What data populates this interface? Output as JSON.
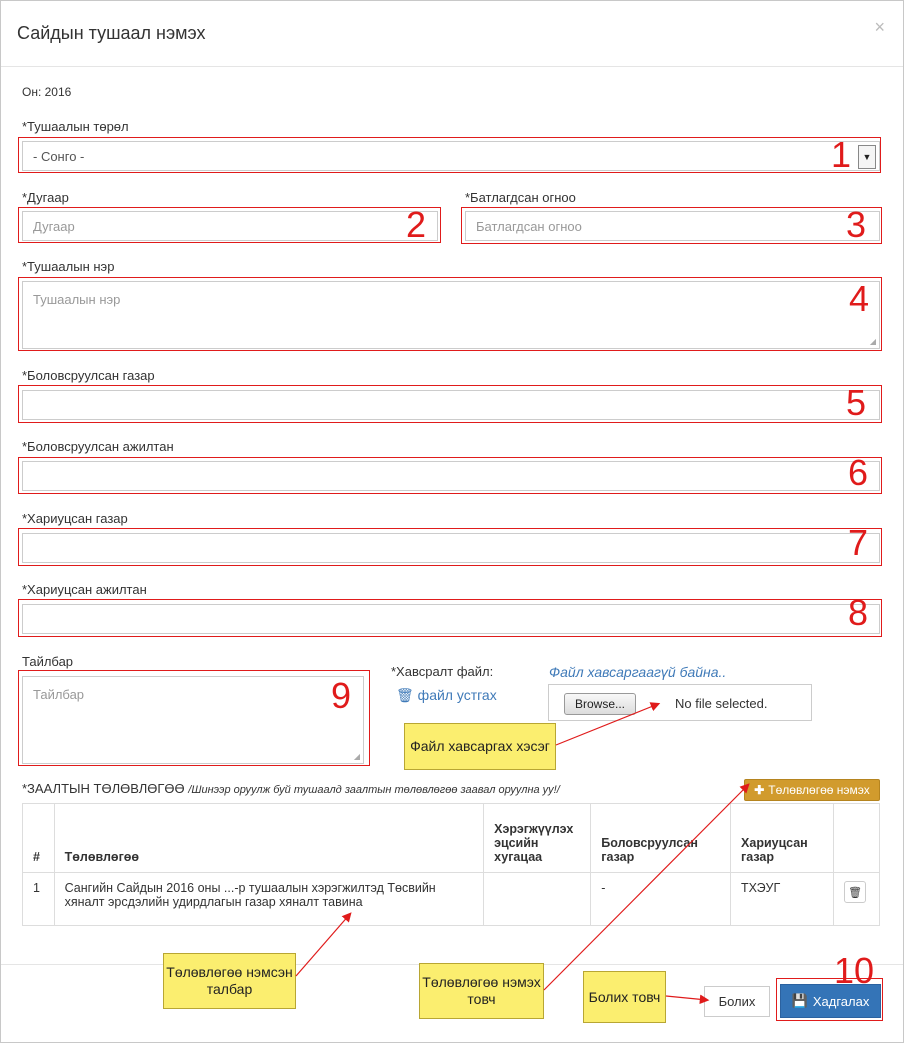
{
  "dialog": {
    "title": "Сайдын тушаал нэмэх",
    "close_symbol": "×",
    "year_label": "Он: 2016"
  },
  "form": {
    "order_type_label": "*Тушаалын төрөл",
    "order_type_value": "- Сонго -",
    "number_label": "*Дугаар",
    "number_placeholder": "Дугаар",
    "approved_date_label": "*Батлагдсан огноо",
    "approved_date_placeholder": "Батлагдсан огноо",
    "order_name_label": "*Тушаалын нэр",
    "order_name_placeholder": "Тушаалын нэр",
    "developed_org_label": "*Боловсруулсан газар",
    "developed_staff_label": "*Боловсруулсан ажилтан",
    "responsible_org_label": "*Хариуцсан газар",
    "responsible_staff_label": "*Хариуцсан ажилтан",
    "note_label": "Тайлбар",
    "note_placeholder": "Тайлбар"
  },
  "attachment": {
    "label": "*Хавсралт файл:",
    "status": "Файл хавсаргаагүй байна..",
    "delete_link": "файл устгах",
    "browse_button": "Browse...",
    "no_file": "No file selected."
  },
  "plan": {
    "heading": "*ЗААЛТЫН ТӨЛӨВЛӨГӨӨ",
    "heading_note": "/Шинээр оруулж буй тушаалд заалтын төлөвлөгөө заавал оруулна уу!/",
    "add_button": "Төлөвлөгөө нэмэх",
    "columns": [
      "#",
      "Төлөвлөгөө",
      "Хэрэгжүүлэх эцсийн хугацаа",
      "Боловсруулсан газар",
      "Хариуцсан газар",
      ""
    ],
    "rows": [
      {
        "index": "1",
        "plan": "Сангийн Сайдын 2016 оны ...-р тушаалын хэрэгжилтэд Төсвийн хяналт эрсдэлийн удирдлагын газар хяналт тавина",
        "deadline": "",
        "developed_by": "-",
        "responsible": "ТХЭУГ"
      }
    ]
  },
  "footer": {
    "cancel_button": "Болих",
    "save_button": "Хадгалах"
  },
  "annotations": {
    "numbers": [
      "1",
      "2",
      "3",
      "4",
      "5",
      "6",
      "7",
      "8",
      "9",
      "10"
    ],
    "file_section": "Файл хавсаргах хэсэг",
    "plan_field": "Төлөвлөгөө нэмсэн талбар",
    "plan_add_button": "Төлөвлөгөө нэмэх товч",
    "cancel_button": "Болих товч"
  },
  "colors": {
    "annotation_red": "#e01b1b",
    "callout_yellow": "#fbee6f",
    "save_blue": "#3474b7",
    "add_gold": "#d19b2d",
    "link_blue": "#3f7ab8"
  },
  "icons": {
    "close": "close-icon",
    "caret": "chevron-down-icon",
    "trash": "trash-icon",
    "plus": "plus-icon",
    "save": "floppy-disk-icon"
  }
}
